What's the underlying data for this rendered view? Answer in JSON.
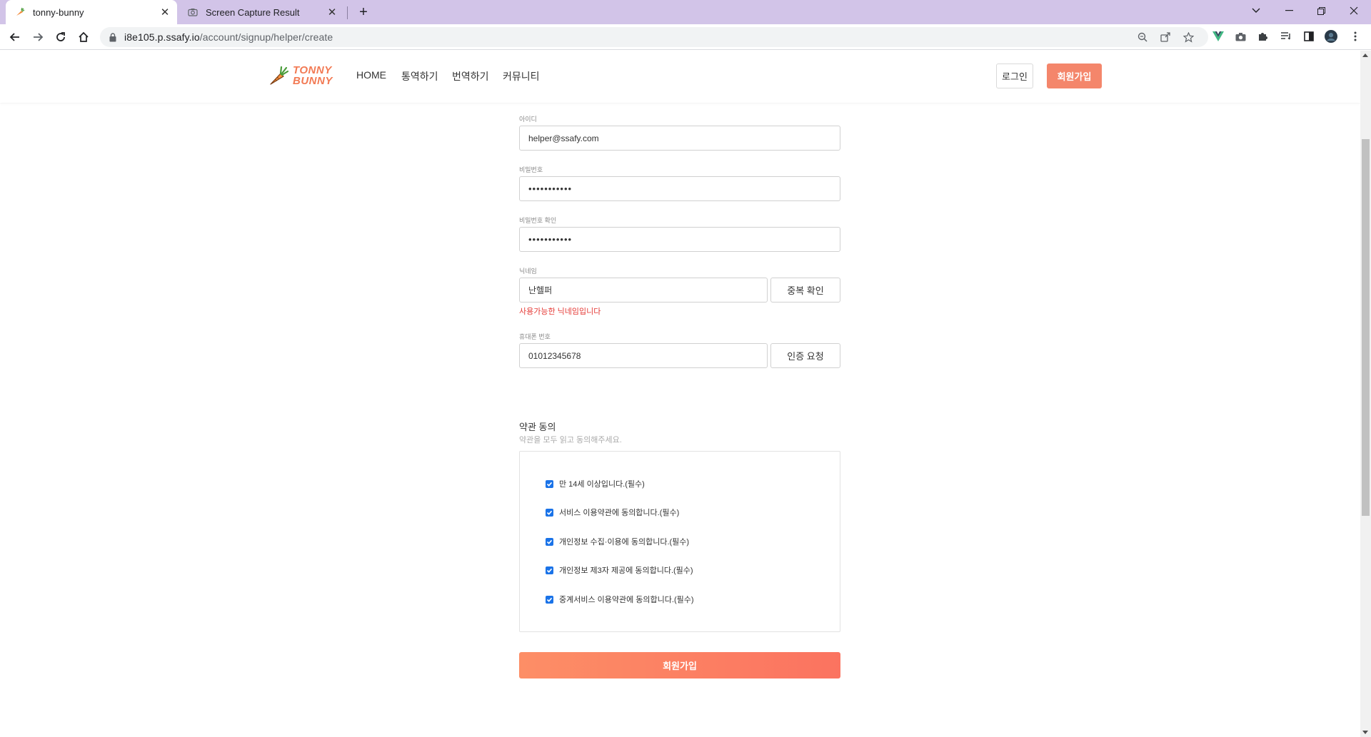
{
  "browser": {
    "tabs": [
      {
        "title": "tonny-bunny",
        "active": true,
        "icon": "carrot-icon"
      },
      {
        "title": "Screen Capture Result",
        "active": false,
        "icon": "camera-icon"
      }
    ],
    "new_tab_symbol": "+",
    "url_host": "i8e105.p.ssafy.io",
    "url_path": "/account/signup/helper/create"
  },
  "header": {
    "logo_line1": "TONNY",
    "logo_line2": "BUNNY",
    "nav": [
      "HOME",
      "통역하기",
      "번역하기",
      "커뮤니티"
    ],
    "login_label": "로그인",
    "signup_label": "회원가입",
    "accent_color": "#f4866b"
  },
  "form": {
    "id_label": "아이디",
    "id_value": "helper@ssafy.com",
    "pw_label": "비밀번호",
    "pw_value": "•••••••••••",
    "pw_confirm_label": "비밀번호 확인",
    "pw_confirm_value": "•••••••••••",
    "nickname_label": "닉네임",
    "nickname_value": "난헬퍼",
    "nickname_check_label": "중복 확인",
    "nickname_msg": "사용가능한 닉네임입니다",
    "phone_label": "휴대폰 번호",
    "phone_value": "01012345678",
    "phone_verify_label": "인증 요청"
  },
  "terms": {
    "title": "약관 동의",
    "subtitle": "약관을 모두 읽고 동의해주세요.",
    "items": [
      {
        "label": "만 14세 이상입니다.(필수)",
        "checked": true
      },
      {
        "label": "서비스 이용약관에 동의합니다.(필수)",
        "checked": true
      },
      {
        "label": "개인정보 수집·이용에 동의합니다.(필수)",
        "checked": true
      },
      {
        "label": "개인정보 제3자 제공에 동의합니다.(필수)",
        "checked": true
      },
      {
        "label": "중계서비스 이용약관에 동의합니다.(필수)",
        "checked": true
      }
    ]
  },
  "submit_label": "회원가입"
}
